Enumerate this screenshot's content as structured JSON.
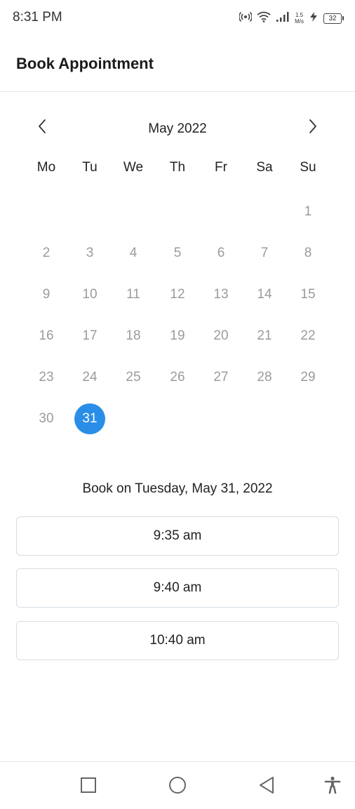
{
  "status_bar": {
    "time": "8:31 PM",
    "speed_value": "1.5",
    "speed_unit": "M/s",
    "battery_level": "32",
    "icons": [
      "hotspot-icon",
      "wifi-icon",
      "signal-icon",
      "charging-icon",
      "battery-icon"
    ]
  },
  "header": {
    "title": "Book Appointment"
  },
  "calendar": {
    "month_label": "May 2022",
    "prev_icon": "chevron-left-icon",
    "next_icon": "chevron-right-icon",
    "weekdays": [
      "Mo",
      "Tu",
      "We",
      "Th",
      "Fr",
      "Sa",
      "Su"
    ],
    "days": [
      "1",
      "2",
      "3",
      "4",
      "5",
      "6",
      "7",
      "8",
      "9",
      "10",
      "11",
      "12",
      "13",
      "14",
      "15",
      "16",
      "17",
      "18",
      "19",
      "20",
      "21",
      "22",
      "23",
      "24",
      "25",
      "26",
      "27",
      "28",
      "29",
      "30",
      "31"
    ],
    "first_weekday_index": 6,
    "selected_day": "31"
  },
  "booking": {
    "label": "Book on Tuesday, May 31, 2022",
    "time_slots": [
      "9:35 am",
      "9:40 am",
      "10:40 am"
    ]
  },
  "navbar": {
    "icons": [
      "recent-apps-icon",
      "home-icon",
      "back-icon",
      "accessibility-icon"
    ]
  },
  "colors": {
    "accent": "#2a8ee8",
    "muted_day": "#9b9b9b",
    "text": "#222222"
  }
}
